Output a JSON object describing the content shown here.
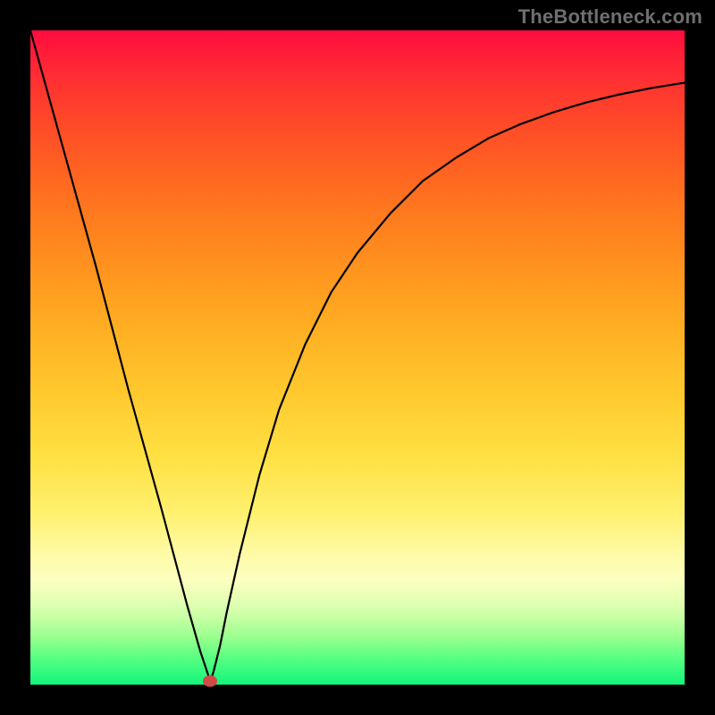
{
  "watermark": "TheBottleneck.com",
  "chart_data": {
    "type": "line",
    "title": "",
    "xlabel": "",
    "ylabel": "",
    "xlim": [
      0,
      100
    ],
    "ylim": [
      0,
      100
    ],
    "grid": false,
    "series": [
      {
        "name": "bottleneck-curve",
        "x": [
          0,
          5,
          10,
          15,
          20,
          24,
          26,
          27,
          27.5,
          28,
          29,
          30,
          32,
          35,
          38,
          42,
          46,
          50,
          55,
          60,
          65,
          70,
          75,
          80,
          85,
          90,
          95,
          100
        ],
        "y": [
          100,
          82,
          64,
          45,
          27,
          12,
          5,
          2,
          0.5,
          2,
          6,
          11,
          20,
          32,
          42,
          52,
          60,
          66,
          72,
          77,
          80.5,
          83.5,
          85.7,
          87.5,
          89,
          90.2,
          91.2,
          92
        ]
      }
    ],
    "optimum_point": {
      "x": 27.5,
      "y": 0.5
    },
    "colors": {
      "curve": "#000000",
      "marker": "#d24a48",
      "background_top": "#ff0b3f",
      "background_bottom": "#12f57b",
      "frame": "#000000"
    }
  }
}
